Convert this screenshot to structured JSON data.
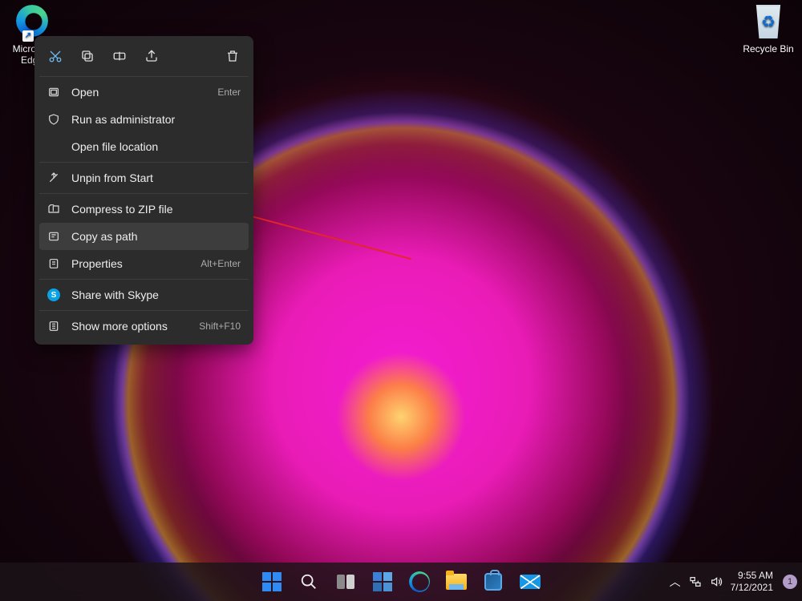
{
  "desktop": {
    "icons": {
      "edge": "Microsoft Edge",
      "recycle": "Recycle Bin"
    }
  },
  "context_menu": {
    "top_buttons": [
      "cut",
      "copy",
      "rename",
      "share",
      "delete"
    ],
    "items": [
      {
        "icon": "open",
        "label": "Open",
        "shortcut": "Enter"
      },
      {
        "icon": "admin",
        "label": "Run as administrator",
        "shortcut": ""
      },
      {
        "icon": "",
        "label": "Open file location",
        "shortcut": ""
      },
      {
        "sep": true
      },
      {
        "icon": "unpin",
        "label": "Unpin from Start",
        "shortcut": ""
      },
      {
        "sep": true
      },
      {
        "icon": "zip",
        "label": "Compress to ZIP file",
        "shortcut": ""
      },
      {
        "icon": "copypath",
        "label": "Copy as path",
        "shortcut": "",
        "highlight": true
      },
      {
        "icon": "props",
        "label": "Properties",
        "shortcut": "Alt+Enter"
      },
      {
        "sep": true
      },
      {
        "icon": "skype",
        "label": "Share with Skype",
        "shortcut": ""
      },
      {
        "sep": true
      },
      {
        "icon": "more",
        "label": "Show more options",
        "shortcut": "Shift+F10"
      }
    ]
  },
  "taskbar": {
    "apps": [
      "start",
      "search",
      "taskview",
      "widgets",
      "edge",
      "explorer",
      "store",
      "mail"
    ]
  },
  "tray": {
    "time": "9:55 AM",
    "date": "7/12/2021",
    "notif_count": "1"
  }
}
